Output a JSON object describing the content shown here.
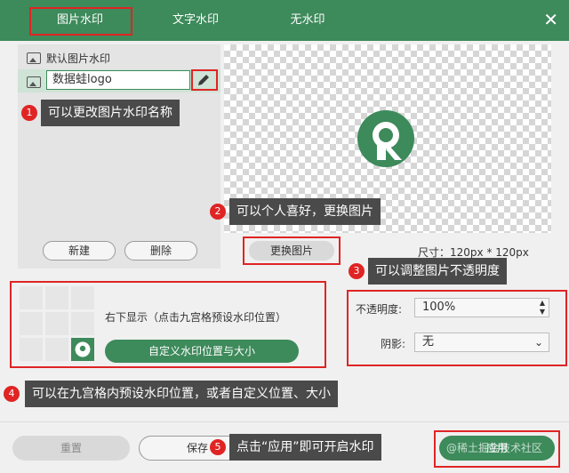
{
  "tabs": [
    {
      "label": "图片水印"
    },
    {
      "label": "文字水印"
    },
    {
      "label": "无水印"
    }
  ],
  "watermark_list": {
    "items": [
      {
        "label": "默认图片水印"
      },
      {
        "label": "数据蛙logo"
      }
    ]
  },
  "left_buttons": {
    "new": "新建",
    "delete": "删除"
  },
  "preview": {
    "change_button": "更换图片",
    "size_text": "尺寸：120px * 120px"
  },
  "position": {
    "description": "右下显示（点击九宫格预设水印位置）",
    "custom_button": "自定义水印位置与大小"
  },
  "settings": {
    "opacity_label": "不透明度:",
    "opacity_value": "100%",
    "shadow_label": "阴影:",
    "shadow_value": "无"
  },
  "footer": {
    "reset": "重置",
    "save": "保存",
    "apply": "应用"
  },
  "annotations": [
    {
      "num": "1",
      "text": "可以更改图片水印名称"
    },
    {
      "num": "2",
      "text": "可以个人喜好，更换图片"
    },
    {
      "num": "3",
      "text": "可以调整图片不透明度"
    },
    {
      "num": "4",
      "text": "可以在九宫格内预设水印位置，或者自定义位置、大小"
    },
    {
      "num": "5",
      "text": "点击“应用”即可开启水印"
    }
  ],
  "watermark_text": "@稀土掘金技术社区",
  "colors": {
    "brand": "#3d8a5b",
    "annotation": "#e02424"
  }
}
